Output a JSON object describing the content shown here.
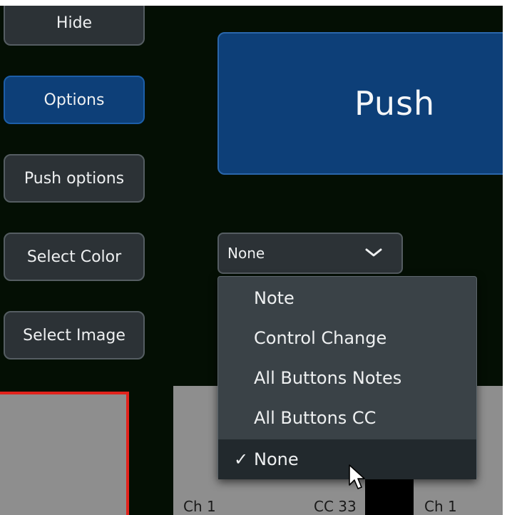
{
  "buttons": {
    "hide": "Hide",
    "options": "Options",
    "push_options": "Push options",
    "select_color": "Select Color",
    "select_image": "Select Image"
  },
  "push_button": {
    "label": "Push"
  },
  "dropdown": {
    "current_value": "None",
    "options": [
      "Note",
      "Control Change",
      "All Buttons Notes",
      "All Buttons CC",
      "None"
    ],
    "selected_option": "None",
    "check_glyph": "✓"
  },
  "tiles": {
    "labels": [
      "Ch 1",
      "CC 33",
      "Ch 1"
    ]
  },
  "icons": {
    "dropdown_chevron": "chevron-down-icon",
    "selected_check": "checkmark-icon",
    "cursor": "mouse-pointer-icon"
  },
  "colors": {
    "background": "#040f04",
    "active_button": "#0d3f78",
    "button": "#2c3236",
    "tile": "#8e8e8e",
    "tile_border": "#e2231c",
    "menu": "#3a4247"
  }
}
